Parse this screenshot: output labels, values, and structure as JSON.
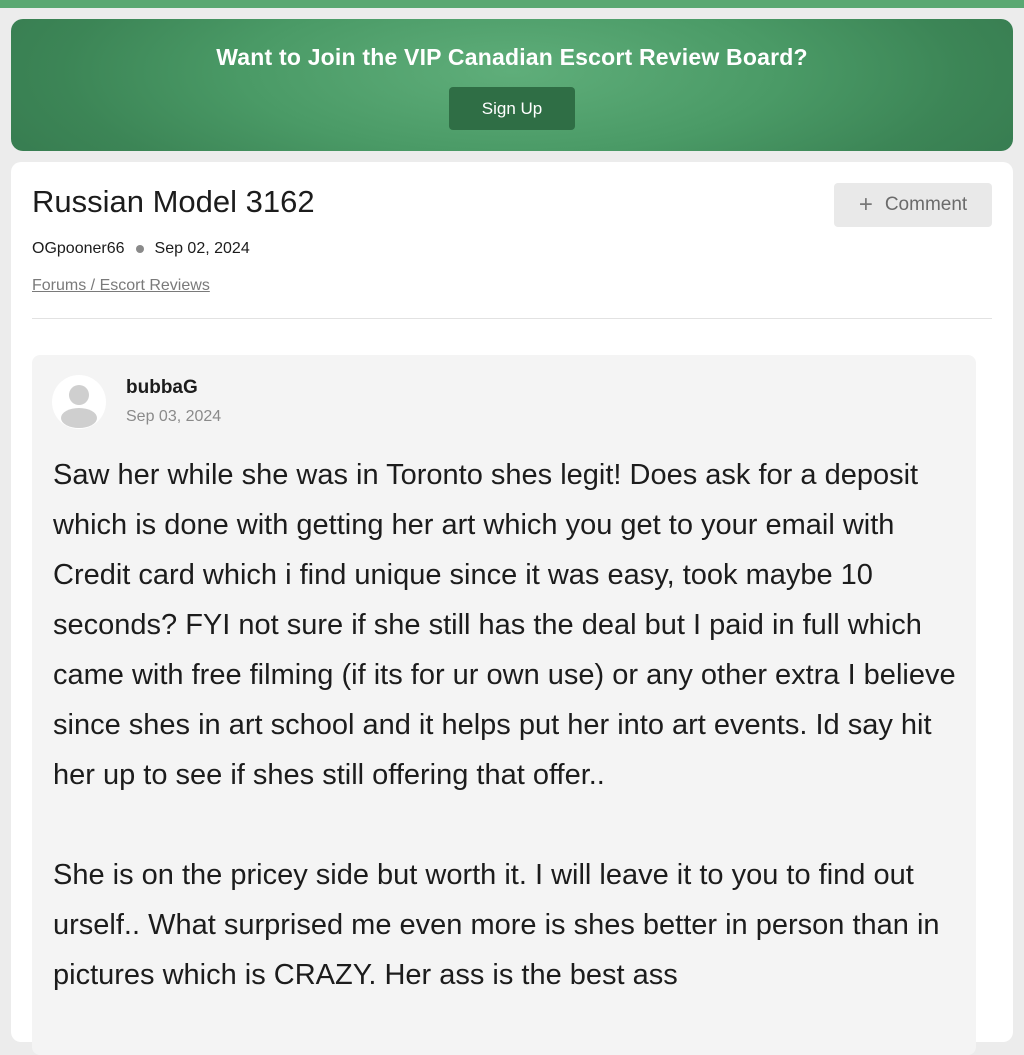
{
  "banner": {
    "title": "Want to Join the VIP Canadian Escort Review Board?",
    "signup_label": "Sign Up",
    "colors": {
      "banner_green": "#4a9a66",
      "button_green": "#2f6e45"
    }
  },
  "post": {
    "title": "Russian Model 3162",
    "comment_button_label": "Comment",
    "comment_icon": "plus-icon",
    "author": "OGpooner66",
    "date": "Sep 02, 2024",
    "breadcrumb": "Forums / Escort Reviews"
  },
  "comment": {
    "avatar_icon": "user-avatar-icon",
    "author": "bubbaG",
    "date": "Sep 03, 2024",
    "paragraphs": [
      "Saw her while she was in Toronto shes legit! Does ask for a deposit which is done with getting her art which you get to your email with Credit card which i find unique since it was easy, took maybe 10 seconds? FYI not sure if she still has the deal but I paid in full which came with free filming (if its for ur own use) or any other extra I believe since shes in art school and it helps put her into art events. Id say hit her up to see if shes still offering that offer..",
      "She is on the pricey side but worth it. I will leave it to you to find out urself.. What surprised me even more is shes better in person than in pictures which is CRAZY. Her ass is the best ass"
    ]
  }
}
